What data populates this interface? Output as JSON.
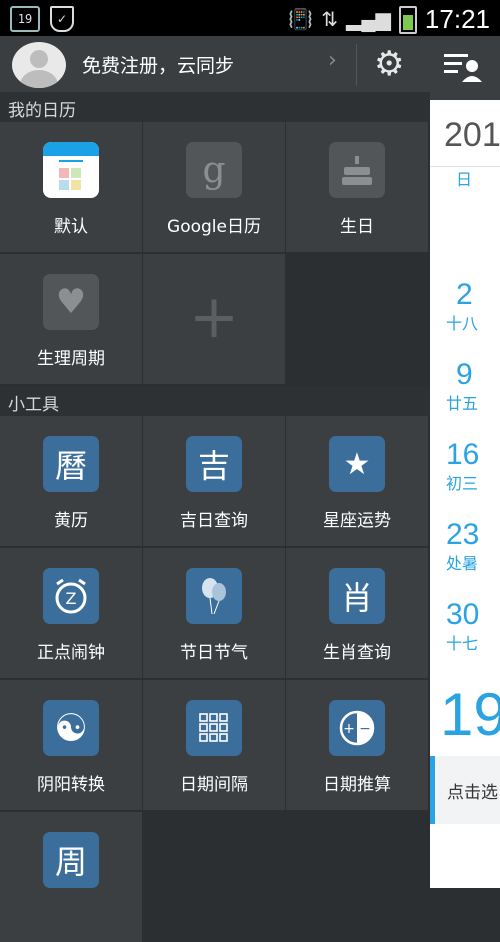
{
  "status_bar": {
    "notification_date": "19",
    "time": "17:21",
    "icons": [
      "calendar-notification-icon",
      "shield-icon",
      "phone-vibrate-icon",
      "data-transfer-icon",
      "signal-icon",
      "battery-icon"
    ]
  },
  "header": {
    "register_text": "免费注册，云同步"
  },
  "sections": {
    "my_calendars": "我的日历",
    "tools": "小工具"
  },
  "calendars": [
    {
      "label": "默认",
      "icon": "default-calendar-icon"
    },
    {
      "label": "Google日历",
      "icon": "google-icon"
    },
    {
      "label": "生日",
      "icon": "birthday-cake-icon"
    },
    {
      "label": "生理周期",
      "icon": "heart-icon"
    }
  ],
  "tools": [
    {
      "label": "黄历",
      "glyph": "曆"
    },
    {
      "label": "吉日查询",
      "glyph": "吉"
    },
    {
      "label": "星座运势",
      "glyph": "★"
    },
    {
      "label": "正点闹钟",
      "glyph": "Z"
    },
    {
      "label": "节日节气",
      "glyph": "balloon"
    },
    {
      "label": "生肖查询",
      "glyph": "肖"
    },
    {
      "label": "阴阳转换",
      "glyph": "☯"
    },
    {
      "label": "日期间隔",
      "glyph": "grid"
    },
    {
      "label": "日期推算",
      "glyph": "±"
    },
    {
      "label": "周",
      "glyph": "周"
    }
  ],
  "right_panel": {
    "year": "201",
    "weekday": "日",
    "days": [
      {
        "num": "2",
        "lunar": "十八"
      },
      {
        "num": "9",
        "lunar": "廿五"
      },
      {
        "num": "16",
        "lunar": "初三"
      },
      {
        "num": "23",
        "lunar": "处暑"
      },
      {
        "num": "30",
        "lunar": "十七"
      }
    ],
    "today": "19",
    "tap_text": "点击选"
  },
  "colors": {
    "accent": "#2aa3e3",
    "tool_tile": "#3c6e9c",
    "cell_bg": "#3b3f42"
  }
}
